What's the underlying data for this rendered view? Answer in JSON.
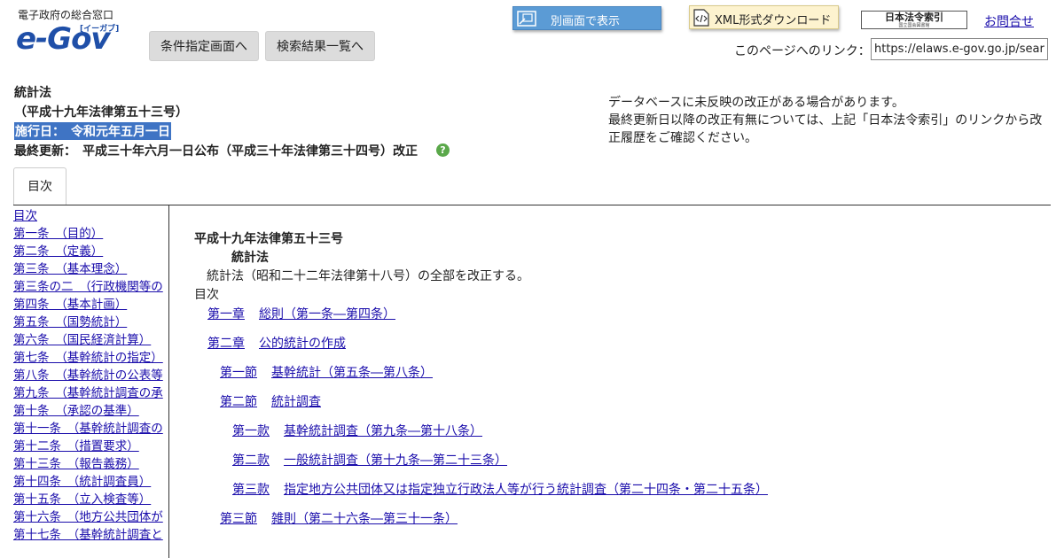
{
  "header": {
    "logo_tagline": "電子政府の総合窓口",
    "logo_text": "e-Gov",
    "logo_ruby": "[イーガブ]",
    "nav_buttons": [
      "条件指定画面へ",
      "検索結果一覧へ"
    ],
    "separate_window_label": "別画面で表示",
    "xml_download_label": "XML形式ダウンロード",
    "index_badge_title": "日本法令索引",
    "index_badge_sub": "国立国会図書館",
    "contact_label": "お問合せ",
    "page_link_label": "このページへのリンク：",
    "page_link_value": "https://elaws.e-gov.go.jp/search"
  },
  "law": {
    "title": "統計法",
    "number_paren": "（平成十九年法律第五十三号）",
    "effective_date": "施行日：　令和元年五月一日",
    "last_updated": "最終更新：　平成三十年六月一日公布（平成三十年法律第三十四号）改正",
    "help_symbol": "?"
  },
  "notice": {
    "line1": "データベースに未反映の改正がある場合があります。",
    "line2": "最終更新日以降の改正有無については、上記「日本法令索引」のリンクから改正履歴をご確認ください。"
  },
  "tabs": [
    "目次"
  ],
  "sidebar": {
    "items": [
      "目次",
      "第一条　（目的）",
      "第二条　（定義）",
      "第三条　（基本理念）",
      "第三条の二　（行政機関等の",
      "第四条　（基本計画）",
      "第五条　（国勢統計）",
      "第六条　（国民経済計算）",
      "第七条　（基幹統計の指定）",
      "第八条　（基幹統計の公表等",
      "第九条　（基幹統計調査の承",
      "第十条　（承認の基準）",
      "第十一条　（基幹統計調査の",
      "第十二条　（措置要求）",
      "第十三条　（報告義務）",
      "第十四条　（統計調査員）",
      "第十五条　（立入検査等）",
      "第十六条　（地方公共団体が",
      "第十七条　（基幹統計調査と"
    ]
  },
  "content": {
    "law_number": "平成十九年法律第五十三号",
    "law_name": "統計法",
    "preamble": "統計法（昭和二十二年法律第十八号）の全部を改正する。",
    "toc_title": "目次",
    "toc": [
      {
        "level": 1,
        "num": "第一章",
        "title": "総則（第一条―第四条）"
      },
      {
        "level": 1,
        "num": "第二章",
        "title": "公的統計の作成"
      },
      {
        "level": 2,
        "num": "第一節",
        "title": "基幹統計（第五条―第八条）"
      },
      {
        "level": 2,
        "num": "第二節",
        "title": "統計調査"
      },
      {
        "level": 3,
        "num": "第一款",
        "title": "基幹統計調査（第九条―第十八条）"
      },
      {
        "level": 3,
        "num": "第二款",
        "title": "一般統計調査（第十九条―第二十三条）"
      },
      {
        "level": 3,
        "num": "第三款",
        "title": "指定地方公共団体又は指定独立行政法人等が行う統計調査（第二十四条・第二十五条）"
      },
      {
        "level": 2,
        "num": "第三節",
        "title": "雑則（第二十六条―第三十一条）"
      }
    ]
  },
  "colors": {
    "link": "#1a0dab",
    "highlight": "#3f74c4",
    "blue_button": "#5b9bd5",
    "xml_button": "#fdf3cf",
    "help_icon": "#5aa84a",
    "logo": "#1f4fa8"
  }
}
